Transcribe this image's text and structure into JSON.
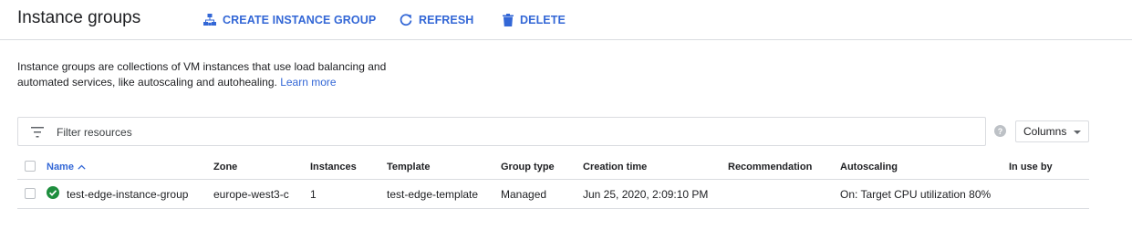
{
  "header": {
    "title": "Instance groups",
    "create_label": "CREATE INSTANCE GROUP",
    "refresh_label": "REFRESH",
    "delete_label": "DELETE"
  },
  "description": {
    "text": "Instance groups are collections of VM instances that use load balancing and automated services, like autoscaling and autohealing.",
    "link": "Learn more"
  },
  "filter": {
    "placeholder": "Filter resources",
    "columns_label": "Columns"
  },
  "colors": {
    "accent": "#3367d6",
    "status_ok": "#1e8e3e",
    "border": "#dadce0"
  },
  "table": {
    "columns": [
      "Name",
      "Zone",
      "Instances",
      "Template",
      "Group type",
      "Creation time",
      "Recommendation",
      "Autoscaling",
      "In use by"
    ],
    "sorted_column": "Name",
    "sort_direction": "ascending",
    "rows": [
      {
        "status": "check-circle-icon",
        "name": "test-edge-instance-group",
        "zone": "europe-west3-c",
        "instances": "1",
        "template": "test-edge-template",
        "group_type": "Managed",
        "creation_time": "Jun 25, 2020, 2:09:10 PM",
        "recommendation": "",
        "autoscaling": "On: Target CPU utilization 80%",
        "in_use_by": ""
      }
    ]
  }
}
